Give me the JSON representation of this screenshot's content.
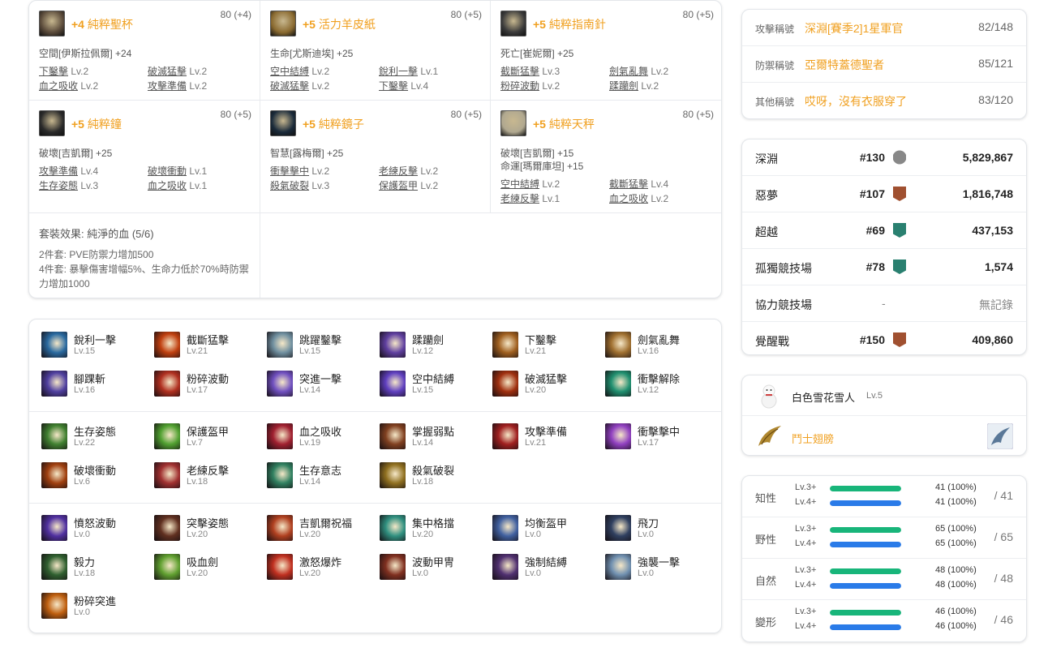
{
  "accessories": [
    {
      "plus": "+4",
      "name": "純粹聖杯",
      "level": "80 (+4)",
      "stats": [
        "空間[伊斯拉佩爾] +24"
      ],
      "engravings": [
        [
          "下鑿擊",
          "Lv.2"
        ],
        [
          "破滅猛擊",
          "Lv.2"
        ],
        [
          "血之吸收",
          "Lv.2"
        ],
        [
          "攻擊準備",
          "Lv.2"
        ]
      ],
      "icon": "chalice-icon",
      "icon_color": "#5a4a3a"
    },
    {
      "plus": "+5",
      "name": "活力羊皮紙",
      "level": "80 (+5)",
      "stats": [
        "生命[尤斯迪埃] +25"
      ],
      "engravings": [
        [
          "空中結縛",
          "Lv.2"
        ],
        [
          "銳利一擊",
          "Lv.1"
        ],
        [
          "破滅猛擊",
          "Lv.2"
        ],
        [
          "下鑿擊",
          "Lv.4"
        ]
      ],
      "icon": "scroll-icon",
      "icon_color": "#8a6a30"
    },
    {
      "plus": "+5",
      "name": "純粹指南針",
      "level": "80 (+5)",
      "stats": [
        "死亡[崔妮爾] +25"
      ],
      "engravings": [
        [
          "截斷猛擊",
          "Lv.3"
        ],
        [
          "劍氣亂舞",
          "Lv.2"
        ],
        [
          "粉碎波動",
          "Lv.2"
        ],
        [
          "蹂躪劍",
          "Lv.2"
        ]
      ],
      "icon": "compass-icon",
      "icon_color": "#3a3a3a"
    },
    {
      "plus": "+5",
      "name": "純粹鐘",
      "level": "80 (+5)",
      "stats": [
        "破壞[吉凱爾] +25"
      ],
      "engravings": [
        [
          "攻擊準備",
          "Lv.4"
        ],
        [
          "破壞衝動",
          "Lv.1"
        ],
        [
          "生存姿態",
          "Lv.3"
        ],
        [
          "血之吸收",
          "Lv.1"
        ]
      ],
      "icon": "bell-icon",
      "icon_color": "#2a2a2a"
    },
    {
      "plus": "+5",
      "name": "純粹鏡子",
      "level": "80 (+5)",
      "stats": [
        "智慧[露梅爾] +25"
      ],
      "engravings": [
        [
          "衝擊擊中",
          "Lv.2"
        ],
        [
          "老練反擊",
          "Lv.2"
        ],
        [
          "殺氣破裂",
          "Lv.3"
        ],
        [
          "保護盔甲",
          "Lv.2"
        ]
      ],
      "icon": "mirror-icon",
      "icon_color": "#1a2a3a"
    },
    {
      "plus": "+5",
      "name": "純粹天秤",
      "level": "80 (+5)",
      "stats": [
        "破壞[吉凱爾] +15",
        "命運[瑪爾庫坦] +15"
      ],
      "engravings": [
        [
          "空中結縛",
          "Lv.2"
        ],
        [
          "截斷猛擊",
          "Lv.4"
        ],
        [
          "老練反擊",
          "Lv.1"
        ],
        [
          "血之吸收",
          "Lv.2"
        ]
      ],
      "icon": "scales-icon",
      "icon_color": "#b0a890"
    }
  ],
  "set_effect": {
    "title": "套裝效果:  純淨的血 (5/6)",
    "two_piece": "2件套:  PVE防禦力增加500",
    "four_piece": "4件套:  暴擊傷害增幅5%、生命力低於70%時防禦力增加1000"
  },
  "engraving_groups": [
    [
      [
        "銳利一擊",
        "Lv.15",
        "#2a6aa0"
      ],
      [
        "截斷猛擊",
        "Lv.21",
        "#c04010"
      ],
      [
        "跳躍鑿擊",
        "Lv.15",
        "#7090a0"
      ],
      [
        "蹂躪劍",
        "Lv.12",
        "#6040a0"
      ],
      [
        "下鑿擊",
        "Lv.21",
        "#a06020"
      ],
      [
        "劍氣亂舞",
        "Lv.16",
        "#a07030"
      ],
      [
        "腳踝斬",
        "Lv.16",
        "#5040a0"
      ],
      [
        "粉碎波動",
        "Lv.17",
        "#b03020"
      ],
      [
        "突進一擊",
        "Lv.14",
        "#7050c0"
      ],
      [
        "空中結縛",
        "Lv.15",
        "#6040c0"
      ],
      [
        "破滅猛擊",
        "Lv.20",
        "#a03010"
      ],
      [
        "衝擊解除",
        "Lv.12",
        "#209070"
      ]
    ],
    [
      [
        "生存姿態",
        "Lv.22",
        "#408030"
      ],
      [
        "保護盔甲",
        "Lv.7",
        "#50a030"
      ],
      [
        "血之吸收",
        "Lv.19",
        "#a02030"
      ],
      [
        "掌握弱點",
        "Lv.14",
        "#804020"
      ],
      [
        "攻擊準備",
        "Lv.21",
        "#a02020"
      ],
      [
        "衝擊擊中",
        "Lv.17",
        "#9040c0"
      ],
      [
        "破壞衝動",
        "Lv.6",
        "#a04010"
      ],
      [
        "老練反擊",
        "Lv.18",
        "#a03030"
      ],
      [
        "生存意志",
        "Lv.14",
        "#308060"
      ],
      [
        "殺氣破裂",
        "Lv.18",
        "#907020"
      ]
    ],
    [
      [
        "憤怒波動",
        "Lv.0",
        "#5030a0"
      ],
      [
        "突擊姿態",
        "Lv.20",
        "#603020"
      ],
      [
        "吉凱爾祝福",
        "Lv.20",
        "#b04020"
      ],
      [
        "集中格擋",
        "Lv.20",
        "#309080"
      ],
      [
        "均衡盔甲",
        "Lv.0",
        "#4060a0"
      ],
      [
        "飛刀",
        "Lv.0",
        "#304060"
      ],
      [
        "毅力",
        "Lv.18",
        "#306030"
      ],
      [
        "吸血劍",
        "Lv.20",
        "#60a030"
      ],
      [
        "激怒爆炸",
        "Lv.20",
        "#c03020"
      ],
      [
        "波動甲冑",
        "Lv.0",
        "#803020"
      ],
      [
        "強制結縛",
        "Lv.0",
        "#503070"
      ],
      [
        "強襲一擊",
        "Lv.0",
        "#7090b0"
      ],
      [
        "粉碎突進",
        "Lv.0",
        "#c06010"
      ]
    ]
  ],
  "titles": [
    {
      "label": "攻擊稱號",
      "value": "深淵[賽季2]1星軍官",
      "count": "82/148"
    },
    {
      "label": "防禦稱號",
      "value": "亞爾特蓋德聖者",
      "count": "85/121"
    },
    {
      "label": "其他稱號",
      "value": "哎呀，沒有衣服穿了",
      "count": "83/120"
    }
  ],
  "rankings": [
    {
      "label": "深淵",
      "rank": "#130",
      "score": "5,829,867",
      "badge_color": "#888888"
    },
    {
      "label": "惡夢",
      "rank": "#107",
      "score": "1,816,748",
      "badge_color": "#a05030"
    },
    {
      "label": "超越",
      "rank": "#69",
      "score": "437,153",
      "badge_color": "#2a8070"
    },
    {
      "label": "孤獨競技場",
      "rank": "#78",
      "score": "1,574",
      "badge_color": "#2a8070"
    },
    {
      "label": "協力競技場",
      "rank": "-",
      "score": "無記錄",
      "badge_color": ""
    },
    {
      "label": "覺醒戰",
      "rank": "#150",
      "score": "409,860",
      "badge_color": "#a05030"
    }
  ],
  "pet": {
    "name": "白色雪花雪人",
    "level": "Lv.5"
  },
  "wings": {
    "name": "鬥士翅膀"
  },
  "stats": [
    {
      "name": "知性",
      "lv3": "41 (100%)",
      "lv4": "41 (100%)",
      "max": "/ 41"
    },
    {
      "name": "野性",
      "lv3": "65 (100%)",
      "lv4": "65 (100%)",
      "max": "/ 65"
    },
    {
      "name": "自然",
      "lv3": "48 (100%)",
      "lv4": "48 (100%)",
      "max": "/ 48"
    },
    {
      "name": "變形",
      "lv3": "46 (100%)",
      "lv4": "46 (100%)",
      "max": "/ 46"
    }
  ],
  "stat_labels": {
    "lv3": "Lv.3+",
    "lv4": "Lv.4+"
  },
  "stat_fill": 1.0,
  "colors": {
    "accent": "#f0a020",
    "bar_green": "#18b57a",
    "bar_blue": "#2a7be8"
  }
}
